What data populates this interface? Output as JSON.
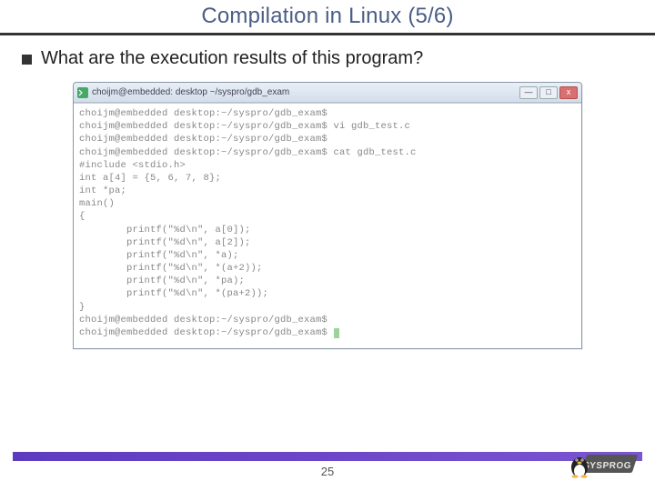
{
  "title": "Compilation in Linux (5/6)",
  "bullet": "What are the execution results of this program?",
  "term": {
    "icon_glyph": "⌘",
    "titlebar": "choijm@embedded: desktop  ~/syspro/gdb_exam",
    "btn_min": "—",
    "btn_max": "□",
    "btn_close": "x",
    "lines": [
      "choijm@embedded desktop:~/syspro/gdb_exam$",
      "choijm@embedded desktop:~/syspro/gdb_exam$ vi gdb_test.c",
      "choijm@embedded desktop:~/syspro/gdb_exam$",
      "choijm@embedded desktop:~/syspro/gdb_exam$ cat gdb_test.c",
      "#include <stdio.h>",
      "",
      "int a[4] = {5, 6, 7, 8};",
      "int *pa;",
      "",
      "main()",
      "{",
      "        printf(\"%d\\n\", a[0]);",
      "        printf(\"%d\\n\", a[2]);",
      "        printf(\"%d\\n\", *a);",
      "        printf(\"%d\\n\", *(a+2));",
      "        printf(\"%d\\n\", *pa);",
      "        printf(\"%d\\n\", *(pa+2));",
      "}",
      "choijm@embedded desktop:~/syspro/gdb_exam$",
      "choijm@embedded desktop:~/syspro/gdb_exam$ "
    ]
  },
  "page_number": "25",
  "logo_text": "SYSPROG"
}
